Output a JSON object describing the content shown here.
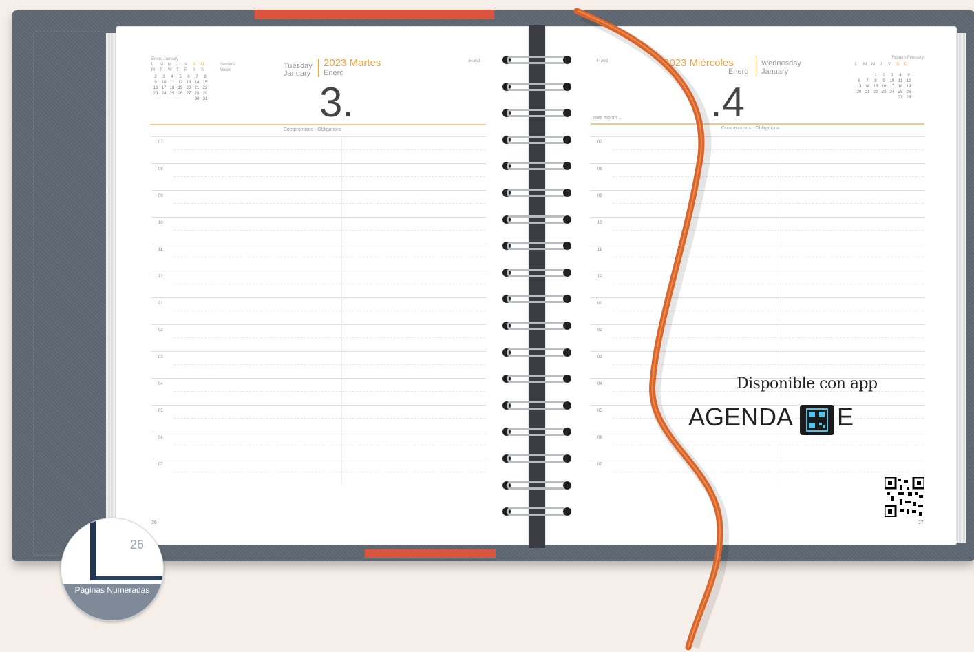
{
  "left_page": {
    "calendar_title": "Enero January",
    "calendar_week_label": "Semana Week",
    "calendar_days_header": [
      "L",
      "M",
      "M",
      "J",
      "V",
      "S",
      "D"
    ],
    "calendar_days_header_en": [
      "M",
      "T",
      "W",
      "T",
      "F",
      "S",
      "S"
    ],
    "calendar_rows": [
      "2 3 4 5 6 7 8",
      "9 10 11 12 13 14 15",
      "16 17 18 19 20 21 22",
      "23 24 25 26 27 28 29",
      "30 31"
    ],
    "day_en": "Tuesday",
    "month_en": "January",
    "year_day_es": "2023 Martes",
    "month_es": "Enero",
    "day_number": "3.",
    "day_of_year": "3-362",
    "section_label": "Compromisos · Obligations",
    "hours": [
      "07",
      "08",
      "09",
      "10",
      "11",
      "12",
      "01",
      "02",
      "03",
      "04",
      "05",
      "06",
      "07"
    ],
    "page_number": "26"
  },
  "right_page": {
    "day_of_year": "4-361",
    "year_day_es": "2023 Miércoles",
    "month_es": "Enero",
    "day_en": "Wednesday",
    "month_en": "January",
    "day_number": ".4",
    "month_label": "mes month 1",
    "section_label": "Compromisos · Obligations",
    "calendar_title": "Febrero February",
    "calendar_days_header": [
      "L",
      "M",
      "M",
      "J",
      "V",
      "S",
      "D"
    ],
    "calendar_rows": [
      "1 2 3 4 5",
      "6 7 8 9 10 11 12",
      "13 14 15 16 17 18 19",
      "20 21 22 23 24 25 26",
      "27 28"
    ],
    "hours": [
      "07",
      "08",
      "09",
      "10",
      "11",
      "12",
      "01",
      "02",
      "03",
      "04",
      "05",
      "06",
      "07"
    ],
    "page_number": "27",
    "promo_line": "Disponible con app",
    "promo_brand_left": "AGENDA",
    "promo_brand_right": "E"
  },
  "badge": {
    "page_number": "26",
    "label": "Páginas Numeradas"
  },
  "colors": {
    "accent_orange": "#f2a23c",
    "ribbon": "#d9652b",
    "cover": "#5f6873",
    "band": "#d9553e"
  }
}
